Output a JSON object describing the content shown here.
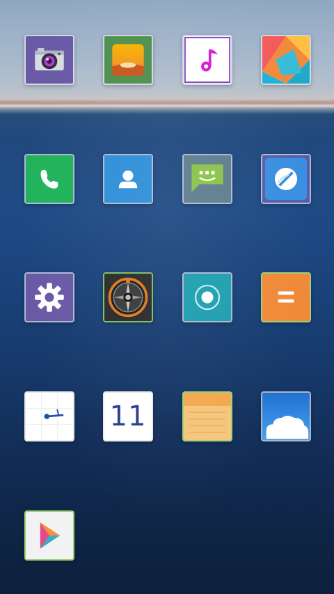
{
  "apps": [
    {
      "id": "camera",
      "label": "Camera"
    },
    {
      "id": "gallery",
      "label": "Gallery"
    },
    {
      "id": "music",
      "label": "Music"
    },
    {
      "id": "themes",
      "label": "Themes"
    },
    {
      "id": "phone",
      "label": "Phone"
    },
    {
      "id": "contacts",
      "label": "Contacts"
    },
    {
      "id": "messages",
      "label": "Messages"
    },
    {
      "id": "browser",
      "label": "Browser"
    },
    {
      "id": "settings",
      "label": "Settings"
    },
    {
      "id": "compass",
      "label": "Compass"
    },
    {
      "id": "recorder",
      "label": "Recorder"
    },
    {
      "id": "calculator",
      "label": "Calculator"
    },
    {
      "id": "clock",
      "label": "Clock"
    },
    {
      "id": "calendar",
      "label": "Calendar",
      "date": "11"
    },
    {
      "id": "notes",
      "label": "Notes"
    },
    {
      "id": "weather",
      "label": "Weather"
    },
    {
      "id": "play-store",
      "label": "Play Store"
    }
  ],
  "colors": {
    "camera_bg": "#6a5aa6",
    "gallery_bg": "#4f8f4f",
    "music_bg": "#ffffff",
    "phone_bg": "#21b35b",
    "contacts_bg": "#2f8fd8",
    "messages_bg": "#5f7f8f",
    "browser_bg": "#3a8fe0",
    "settings_bg": "#6a5aa6",
    "recorder_bg": "#1f9fb0",
    "calculator_bg": "#f08a3a",
    "notes_bg": "#f6c57a",
    "weather_bg": "#2b7fd8"
  }
}
